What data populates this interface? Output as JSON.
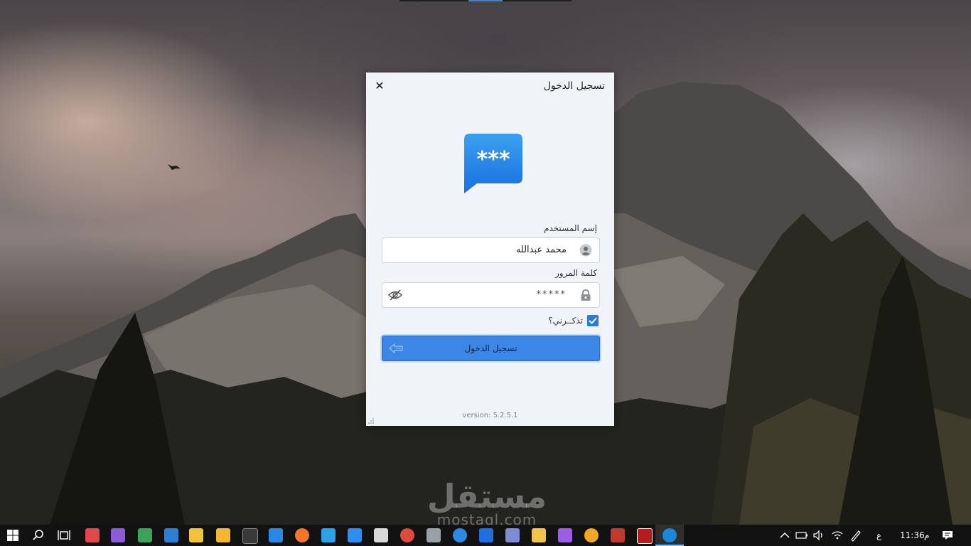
{
  "dialog": {
    "title": "تسجيل الدخول",
    "close_symbol": "✕",
    "logo_text": "***",
    "username_label": "إسم المستخدم",
    "username_value": "محمد عبدالله",
    "password_label": "كلمة المرور",
    "password_value": "*****",
    "remember_label": "تذكــرني؟",
    "remember_checked": true,
    "login_button": "تسجيل الدخول",
    "version": "version: 5.2.5.1"
  },
  "watermark": {
    "arabic": "مستقل",
    "latin": "mostaql.com"
  },
  "taskbar": {
    "clock_time": "11:36",
    "clock_ampm": "م",
    "language": "ع",
    "accent": "#76b9ed"
  },
  "colors": {
    "primary": "#3c86e6",
    "dialog_bg": "#f0f3f8"
  }
}
